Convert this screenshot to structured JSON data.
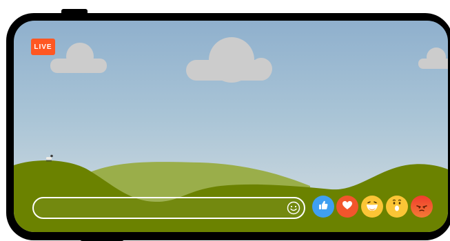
{
  "stream": {
    "live_label": "LIVE"
  },
  "comment": {
    "placeholder": "",
    "value": ""
  },
  "reactions": [
    {
      "name": "like",
      "icon": "thumbs-up-icon",
      "color": "#3f9ff0"
    },
    {
      "name": "love",
      "icon": "heart-icon",
      "color": "#f2552c"
    },
    {
      "name": "haha",
      "icon": "laughing-face-icon",
      "color": "#fbc536"
    },
    {
      "name": "wow",
      "icon": "surprised-face-icon",
      "color": "#fbc536"
    },
    {
      "name": "angry",
      "icon": "angry-face-icon",
      "color": "#f03d2d"
    }
  ],
  "colors": {
    "live_badge": "#ff5722",
    "hill_dark": "#6b8200",
    "hill_light": "#9aae4a",
    "cloud": "#cccccc",
    "sky_top": "#8fb0cd",
    "sky_bottom": "#cad7de"
  }
}
